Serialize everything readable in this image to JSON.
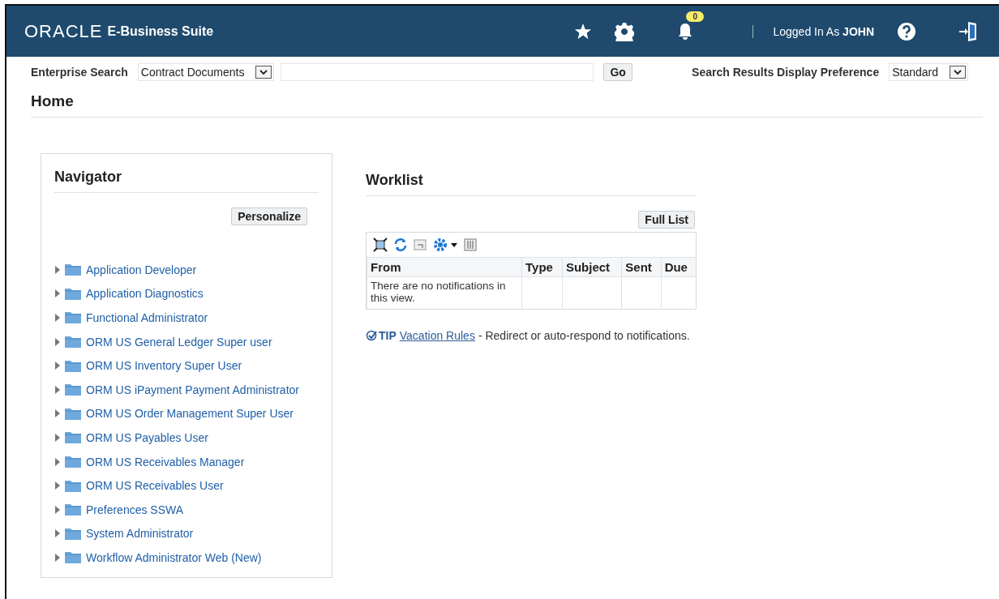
{
  "header": {
    "logo": "ORACLE",
    "product": "E-Business Suite",
    "notification_count": "0",
    "user_label": "Logged In As",
    "user_name": "JOHN"
  },
  "search": {
    "label": "Enterprise Search",
    "category": "Contract Documents",
    "go": "Go",
    "preference_label": "Search Results Display Preference",
    "preference": "Standard"
  },
  "page_title": "Home",
  "navigator": {
    "title": "Navigator",
    "personalize": "Personalize",
    "items": [
      {
        "label": "Application Developer",
        "expanded": false
      },
      {
        "label": "Application Diagnostics",
        "expanded": false
      },
      {
        "label": "Functional Administrator",
        "expanded": false
      },
      {
        "label": "ORM US General Ledger Super user",
        "expanded": false
      },
      {
        "label": "ORM US Inventory Super User",
        "expanded": false
      },
      {
        "label": "ORM US iPayment Payment Administrator",
        "expanded": false
      },
      {
        "label": "ORM US Order Management Super User",
        "expanded": false
      },
      {
        "label": "ORM US Payables User",
        "expanded": false
      },
      {
        "label": "ORM US Receivables Manager",
        "expanded": false
      },
      {
        "label": "ORM US Receivables User",
        "expanded": false
      },
      {
        "label": "Preferences SSWA",
        "expanded": false
      },
      {
        "label": "System Administrator",
        "expanded": false
      },
      {
        "label": "Workflow Administrator Web (New)",
        "expanded": false
      }
    ]
  },
  "worklist": {
    "title": "Worklist",
    "full_list": "Full List",
    "columns": [
      "From",
      "Type",
      "Subject",
      "Sent",
      "Due"
    ],
    "empty_message": "There are no notifications in this view.",
    "tip_label": "TIP",
    "tip_link": "Vacation Rules",
    "tip_text": "- Redirect or auto-respond to notifications."
  }
}
